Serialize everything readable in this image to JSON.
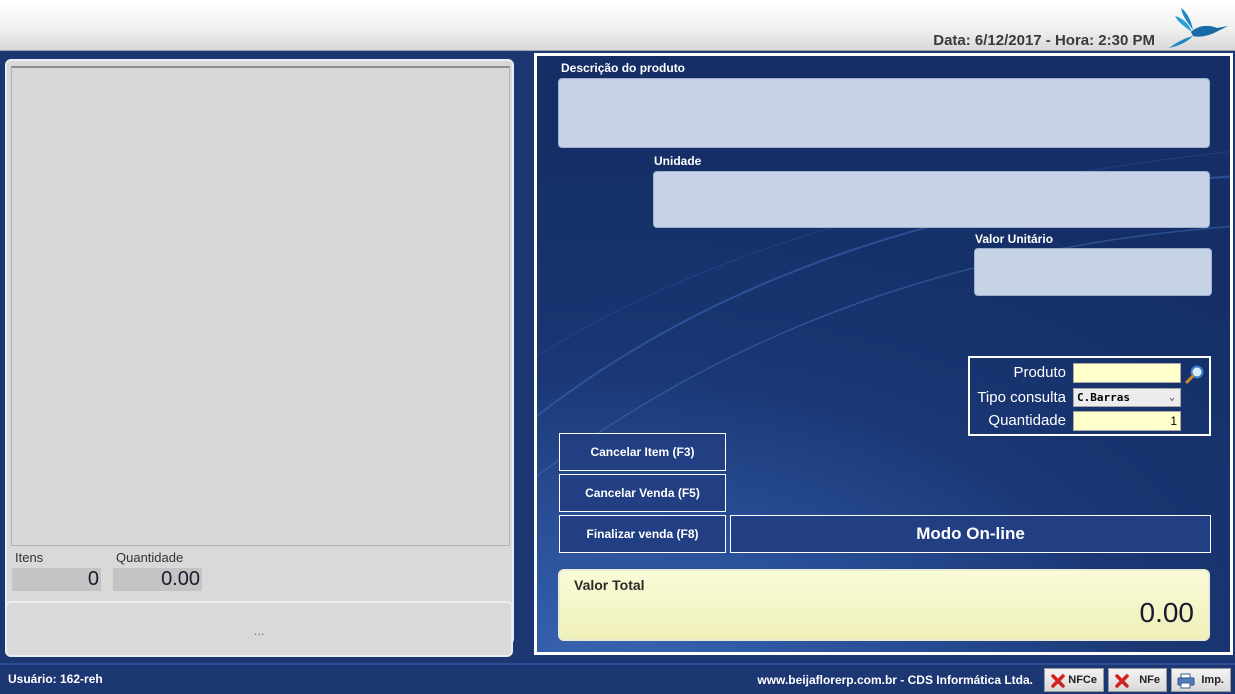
{
  "header": {
    "datetime": "Data: 6/12/2017 - Hora: 2:30 PM"
  },
  "left": {
    "items_label": "Itens",
    "items_value": "0",
    "quantity_label": "Quantidade",
    "quantity_value": "0.00",
    "message": "..."
  },
  "product": {
    "description_label": "Descrição do produto",
    "unit_label": "Unidade",
    "unit_price_label": "Valor Unitário"
  },
  "search": {
    "product_label": "Produto",
    "product_value": "",
    "query_type_label": "Tipo consulta",
    "query_type_value": "C.Barras",
    "quantity_label": "Quantidade",
    "quantity_value": "1"
  },
  "buttons": {
    "cancel_item": "Cancelar Item (F3)",
    "cancel_sale": "Cancelar Venda (F5)",
    "finish_sale": "Finalizar venda (F8)",
    "mode": "Modo On-line"
  },
  "total": {
    "label": "Valor Total",
    "value": "0.00"
  },
  "statusbar": {
    "user": "Usuário: 162-reh",
    "footer": "www.beijaflorerp.com.br - CDS Informática Ltda.",
    "nfce": "NFCe",
    "nfe": "NFe",
    "imp": "Imp."
  }
}
